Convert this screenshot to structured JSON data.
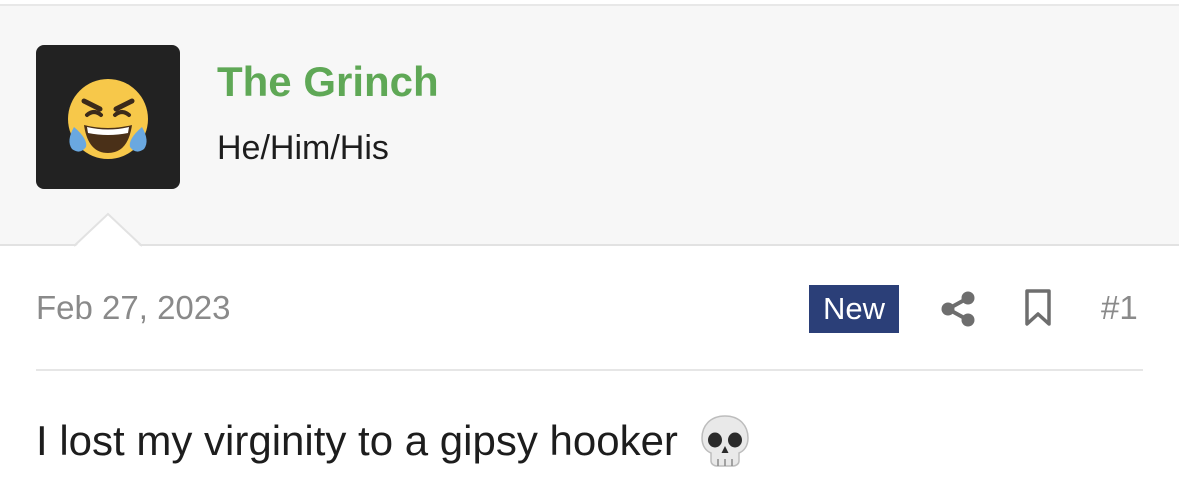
{
  "author": {
    "name": "The Grinch",
    "user_title": "He/Him/His",
    "avatar_icon": "laughing-crying-emoji-icon"
  },
  "post": {
    "date": "Feb 27, 2023",
    "badge": "New",
    "number": "#1",
    "message": "I lost my virginity to a gipsy hooker",
    "message_emoji_icon": "skull-icon"
  },
  "actions": {
    "share_icon": "share-icon",
    "bookmark_icon": "bookmark-icon"
  },
  "colors": {
    "username": "#5fa856",
    "badge_bg": "#2b3f78",
    "header_bg": "#f7f7f7",
    "muted_text": "#8a8a8a"
  }
}
